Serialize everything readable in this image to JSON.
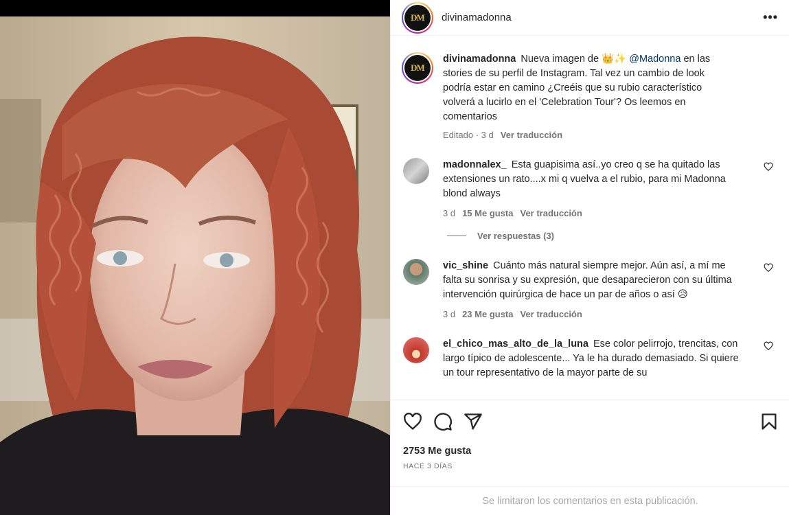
{
  "post": {
    "author": "divinamadonna",
    "caption": {
      "text_before": "Nueva imagen de 👑✨",
      "mention": "@Madonna",
      "text_after": "en las stories de su perfil de Instagram. Tal vez un cambio de look podría estar en camino ¿Creéis que su rubio característico volverá a lucirlo en el 'Celebration Tour'? Os leemos en comentarios",
      "edited": "Editado",
      "age": "3 d",
      "translate": "Ver traducción"
    },
    "likes": "2753 Me gusta",
    "posted": "HACE 3 DÍAS",
    "limited_notice": "Se limitaron los comentarios en esta publicación."
  },
  "header": {
    "avatar_text": "DM",
    "more_label": "•••"
  },
  "comments": [
    {
      "user": "madonnalex_",
      "text": "Esta guapisima así..yo creo q se ha quitado las extensiones un rato....x mi q vuelva a el rubio, para mi Madonna blond always",
      "age": "3 d",
      "likes": "15 Me gusta",
      "translate": "Ver traducción",
      "replies": "Ver respuestas (3)"
    },
    {
      "user": "vic_shine",
      "text": "Cuánto más natural siempre mejor. Aún así, a mí me falta su sonrisa y su expresión, que desaparecieron con su última intervención quirúrgica de hace un par de años o así 😥",
      "age": "3 d",
      "likes": "23 Me gusta",
      "translate": "Ver traducción"
    },
    {
      "user": "el_chico_mas_alto_de_la_luna",
      "text": "Ese color pelirrojo, trencitas, con largo típico de adolescente... Ya le ha durado demasiado. Si quiere un tour representativo de la mayor parte de su"
    }
  ],
  "icons": {
    "like": "heart-icon",
    "comment": "comment-icon",
    "share": "share-icon",
    "save": "bookmark-icon",
    "more": "more-icon"
  },
  "colors": {
    "link": "#00376b",
    "muted": "#737373",
    "border": "#efefef",
    "hair": "#b5513a",
    "skin": "#e6c2b3"
  }
}
